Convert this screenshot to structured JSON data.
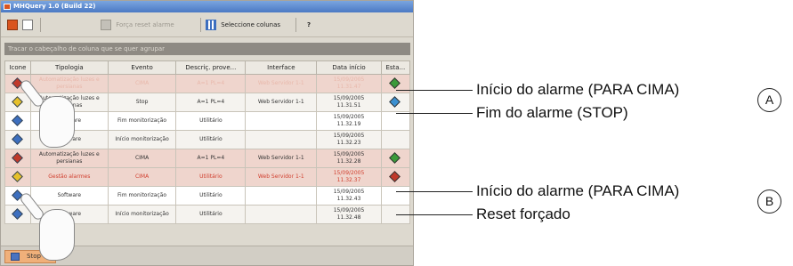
{
  "window": {
    "title": "MHQuery 1.0 (Build 22)"
  },
  "toolbar": {
    "force_reset_label": "Força reset alarme",
    "select_columns_label": "Seleccione colunas",
    "help_label": "?"
  },
  "group_bar": {
    "placeholder": "Tracar o cabeçalho de coluna que se quer agrupar"
  },
  "table": {
    "headers": [
      "Icone",
      "Tipologia",
      "Evento",
      "Descriç. prove...",
      "Interface",
      "Data início",
      "Esta..."
    ],
    "rows": [
      {
        "tipologia": "Automatização luzes e persianas",
        "evento": "CIMA",
        "descr": "A=1 PL=4",
        "interface": "Web Servidor 1-1",
        "date": "15/09/2005",
        "time": "11.31.47",
        "icon_color": "#c0392b",
        "state_color": "#3a9a3a"
      },
      {
        "tipologia": "Automatização luzes e persianas",
        "evento": "Stop",
        "descr": "A=1 PL=4",
        "interface": "Web Servidor 1-1",
        "date": "15/09/2005",
        "time": "11.31.51",
        "icon_color": "#e6c02a",
        "state_color": "#3a8fd0"
      },
      {
        "tipologia": "Software",
        "evento": "Fim monitorização",
        "descr": "Utilitário",
        "interface": "",
        "date": "15/09/2005",
        "time": "11.32.19",
        "icon_color": "#3d6fbf",
        "state_color": ""
      },
      {
        "tipologia": "Software",
        "evento": "Início monitorização",
        "descr": "Utilitário",
        "interface": "",
        "date": "15/09/2005",
        "time": "11.32.23",
        "icon_color": "#3d6fbf",
        "state_color": ""
      },
      {
        "tipologia": "Automatização luzes e persianas",
        "evento": "CIMA",
        "descr": "A=1 PL=4",
        "interface": "Web Servidor 1-1",
        "date": "15/09/2005",
        "time": "11.32.28",
        "icon_color": "#c0392b",
        "state_color": "#3a9a3a"
      },
      {
        "tipologia": "Gestão alarmes",
        "evento": "CIMA",
        "descr": "Utilitário",
        "interface": "Web Servidor 1-1",
        "date": "15/09/2005",
        "time": "11.32.37",
        "icon_color": "#e6c02a",
        "state_color": "#c0392b"
      },
      {
        "tipologia": "Software",
        "evento": "Fim monitorização",
        "descr": "Utilitário",
        "interface": "",
        "date": "15/09/2005",
        "time": "11.32.43",
        "icon_color": "#3d6fbf",
        "state_color": ""
      },
      {
        "tipologia": "Software",
        "evento": "Início monitorização",
        "descr": "Utilitário",
        "interface": "",
        "date": "15/09/2005",
        "time": "11.32.48",
        "icon_color": "#3d6fbf",
        "state_color": ""
      }
    ]
  },
  "bottom": {
    "stop_label": "Stop"
  },
  "annotations": {
    "a1": "Início do alarme (PARA CIMA)",
    "a2": "Fim do alarme (STOP)",
    "b1": "Início do alarme (PARA CIMA)",
    "b2": "Reset forçado",
    "circle_a": "A",
    "circle_b": "B"
  }
}
